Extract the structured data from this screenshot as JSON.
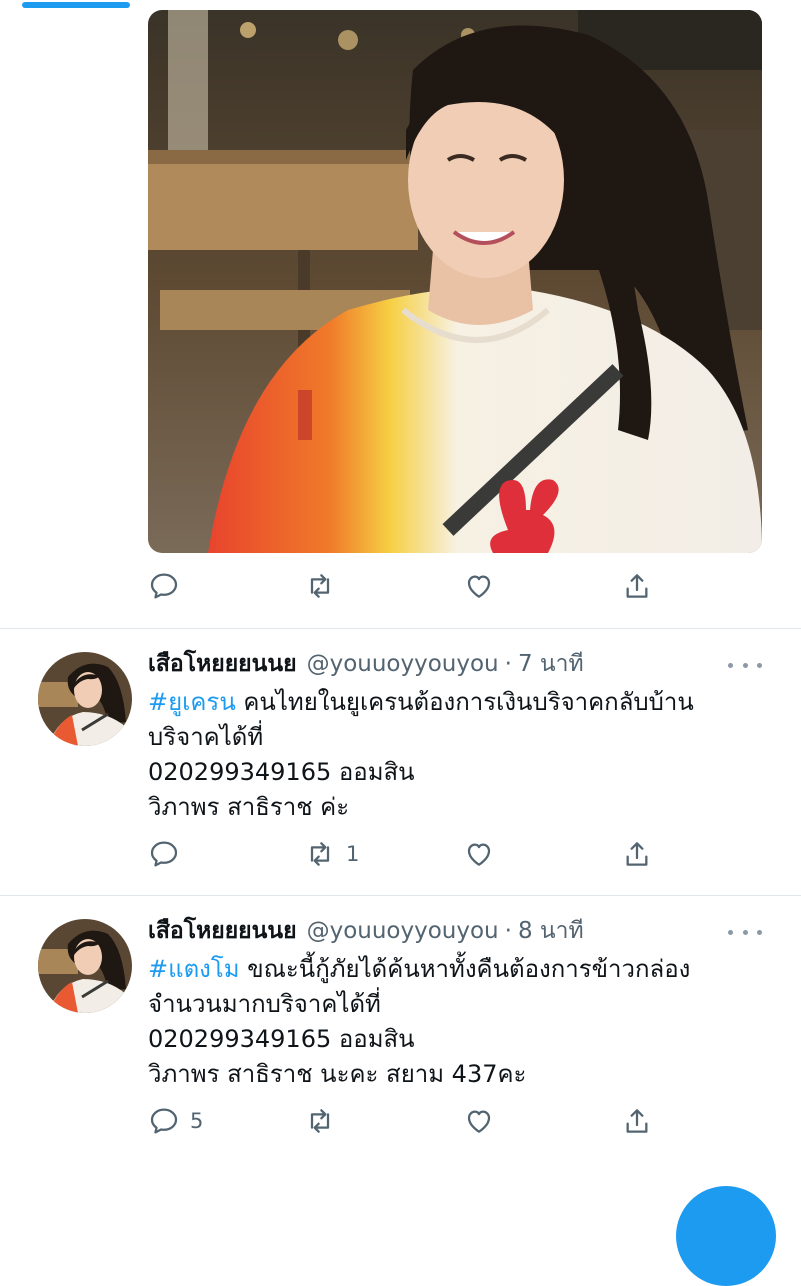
{
  "tweets": [
    {
      "display_name": "เสือโหยยยนนย",
      "handle": "@youuoyyouyou",
      "separator": "·",
      "time": "7 นาที",
      "hashtag": "#ยูเครน",
      "body_line1": " คนไทยในยูเครนต้องการเงินบริจาคกลับบ้าน",
      "body_line2": "บริจาคได้ที่",
      "body_line3": "020299349165 ออมสิน",
      "body_line4": "วิภาพร สาธิราช ค่ะ",
      "reply_count": "",
      "retweet_count": "1",
      "like_count": ""
    },
    {
      "display_name": "เสือโหยยยนนย",
      "handle": "@youuoyyouyou",
      "separator": "·",
      "time": "8 นาที",
      "hashtag": "#แตงโม",
      "body_line1": "  ขณะนี้กู้ภัยได้ค้นหาทั้งคืนต้องการข้าวกล่อง",
      "body_line2": "จำนวนมากบริจาคได้ที่",
      "body_line3": "020299349165 ออมสิน",
      "body_line4": "วิภาพร สาธิราช นะคะ สยาม 437คะ",
      "reply_count": "5",
      "retweet_count": "",
      "like_count": ""
    }
  ],
  "top_tweet": {
    "reply_count": "",
    "retweet_count": "",
    "like_count": ""
  },
  "icons": {
    "reply": "reply-icon",
    "retweet": "retweet-icon",
    "like": "heart-icon",
    "share": "share-icon",
    "more": "more-dots-icon"
  },
  "colors": {
    "accent": "#1d9bf0",
    "text": "#0f1419",
    "secondary": "#536471",
    "divider": "#e1e6ea"
  }
}
